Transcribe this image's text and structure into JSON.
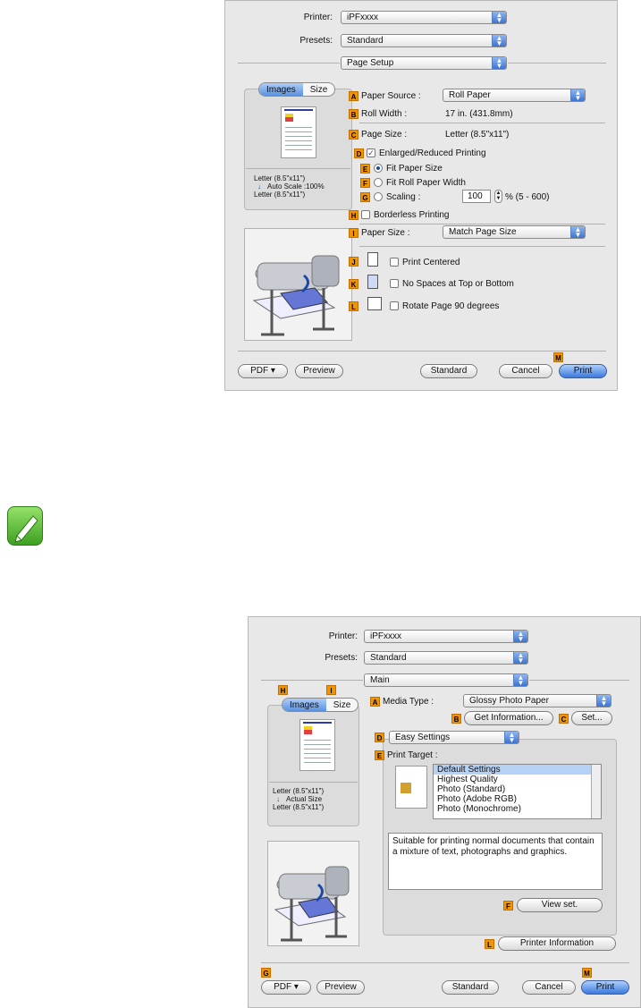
{
  "dialog1": {
    "printer_label": "Printer:",
    "printer_value": "iPFxxxx",
    "presets_label": "Presets:",
    "presets_value": "Standard",
    "panel_value": "Page Setup",
    "tab_images": "Images",
    "tab_size": "Size",
    "preview_text_1": "Letter (8.5\"x11\")",
    "preview_text_2": "Auto Scale :100%",
    "preview_text_3": "Letter (8.5\"x11\")",
    "paper_source_label": "Paper Source :",
    "paper_source_value": "Roll Paper",
    "roll_width_label": "Roll Width :",
    "roll_width_value": "17 in. (431.8mm)",
    "page_size_label": "Page Size :",
    "page_size_value": "Letter (8.5\"x11\")",
    "enlarged_label": "Enlarged/Reduced Printing",
    "fit_paper_label": "Fit Paper Size",
    "fit_roll_label": "Fit Roll Paper Width",
    "scaling_label": "Scaling :",
    "scaling_value": "100",
    "scaling_range": "% (5 - 600)",
    "borderless_label": "Borderless Printing",
    "paper_size_label": "Paper Size :",
    "paper_size_value": "Match Page Size",
    "print_centered_label": "Print Centered",
    "no_spaces_label": "No Spaces at Top or Bottom",
    "rotate_label": "Rotate Page 90 degrees",
    "pdf_label": "PDF ▾",
    "preview_label": "Preview",
    "standard_label": "Standard",
    "cancel_label": "Cancel",
    "print_label": "Print",
    "badges": [
      "A",
      "B",
      "C",
      "D",
      "E",
      "F",
      "G",
      "H",
      "I",
      "J",
      "K",
      "L",
      "M"
    ]
  },
  "dialog2": {
    "printer_label": "Printer:",
    "printer_value": "iPFxxxx",
    "presets_label": "Presets:",
    "presets_value": "Standard",
    "panel_value": "Main",
    "tab_images": "Images",
    "tab_size": "Size",
    "preview_text_1": "Letter (8.5\"x11\")",
    "preview_text_2": "Actual Size",
    "preview_text_3": "Letter (8.5\"x11\")",
    "media_type_label": "Media Type :",
    "media_type_value": "Glossy Photo Paper",
    "get_info_label": "Get Information...",
    "set_label": "Set...",
    "easy_settings_value": "Easy Settings",
    "print_target_label": "Print Target :",
    "targets": [
      "Default Settings",
      "Highest Quality",
      "Photo (Standard)",
      "Photo (Adobe RGB)",
      "Photo (Monochrome)"
    ],
    "description": "Suitable for printing normal documents that contain a mixture of text, photographs and graphics.",
    "view_set_label": "View set.",
    "printer_info_label": "Printer Information",
    "pdf_label": "PDF ▾",
    "preview_label": "Preview",
    "standard_label": "Standard",
    "cancel_label": "Cancel",
    "print_label": "Print",
    "badges": [
      "A",
      "B",
      "C",
      "D",
      "E",
      "F",
      "G",
      "H",
      "I",
      "L",
      "M"
    ]
  },
  "icons": {
    "note": "pencil-note-icon",
    "popup_arrow": "updown-arrow-icon",
    "down_arrow": "down-arrow-icon"
  },
  "colors": {
    "badge": "#f29400",
    "accent": "#3a78dc",
    "note_green": "#3ca020"
  }
}
